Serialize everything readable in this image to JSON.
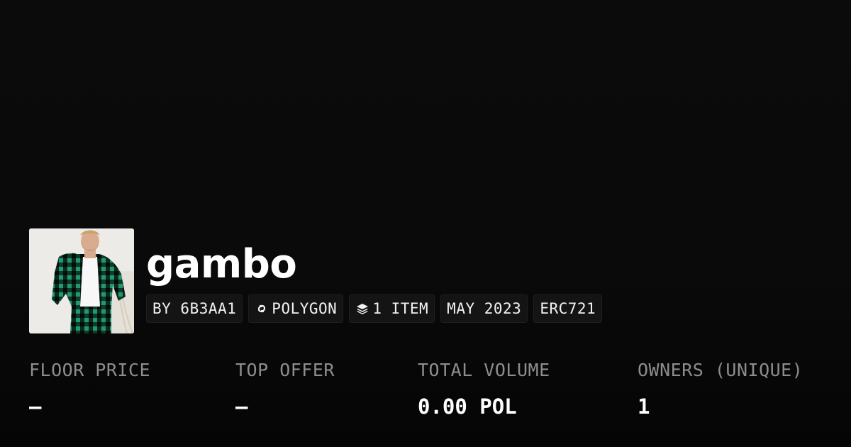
{
  "collection": {
    "name": "gambo",
    "thumbnail_alt": "man in green plaid suit"
  },
  "tags": {
    "creator": "BY 6B3AA1",
    "chain": "POLYGON",
    "chain_icon": "link-icon",
    "items": "1 ITEM",
    "items_icon": "layers-icon",
    "date": "MAY 2023",
    "standard": "ERC721"
  },
  "stats": {
    "floor_price": {
      "label": "FLOOR PRICE",
      "value": "—"
    },
    "top_offer": {
      "label": "TOP OFFER",
      "value": "—"
    },
    "total_volume": {
      "label": "TOTAL VOLUME",
      "value": "0.00 POL"
    },
    "owners": {
      "label": "OWNERS (UNIQUE)",
      "value": "1"
    }
  },
  "colors": {
    "background": "#0a0a0a",
    "tag_background": "#141414",
    "label": "#8d8d8d",
    "text": "#ffffff"
  }
}
